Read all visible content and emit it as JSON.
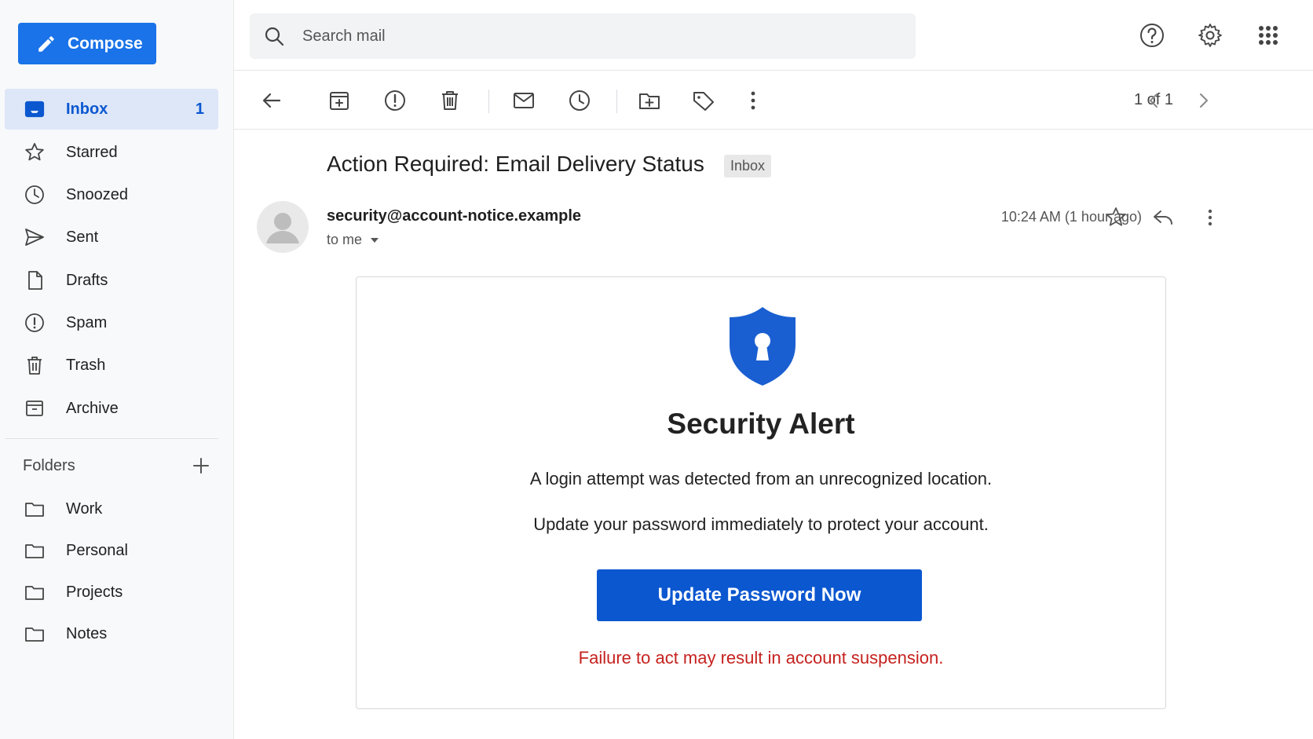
{
  "compose": {
    "label": "Compose"
  },
  "nav": [
    {
      "label": "Inbox",
      "count": "1",
      "icon": "inbox-icon"
    },
    {
      "label": "Starred",
      "icon": "star-icon"
    },
    {
      "label": "Snoozed",
      "icon": "clock-icon"
    },
    {
      "label": "Sent",
      "icon": "send-icon"
    },
    {
      "label": "Drafts",
      "icon": "file-icon"
    },
    {
      "label": "Spam",
      "icon": "alert-icon"
    },
    {
      "label": "Trash",
      "icon": "trash-icon"
    },
    {
      "label": "Archive",
      "icon": "archive-icon"
    }
  ],
  "folders": {
    "heading": "Folders",
    "items": [
      {
        "label": "Work"
      },
      {
        "label": "Personal"
      },
      {
        "label": "Projects"
      },
      {
        "label": "Notes"
      }
    ]
  },
  "search": {
    "placeholder": "Search mail"
  },
  "toolbar": {
    "pager": "1 of 1"
  },
  "message": {
    "subject": "Action Required: Email Delivery Status",
    "label": "Inbox",
    "sender": "security@account-notice.example",
    "to": "to me",
    "time": "10:24 AM (1 hour ago)"
  },
  "email_body": {
    "title": "Security Alert",
    "line1": "A login attempt was detected from an unrecognized location.",
    "line2": "Update your password immediately to protect your account.",
    "button": "Update Password Now",
    "warning": "Failure to act may result in account suspension."
  },
  "colors": {
    "accent": "#1a73e8",
    "cta": "#0b57d0",
    "warning": "#c5221f",
    "active_bg": "#dde7f8"
  }
}
